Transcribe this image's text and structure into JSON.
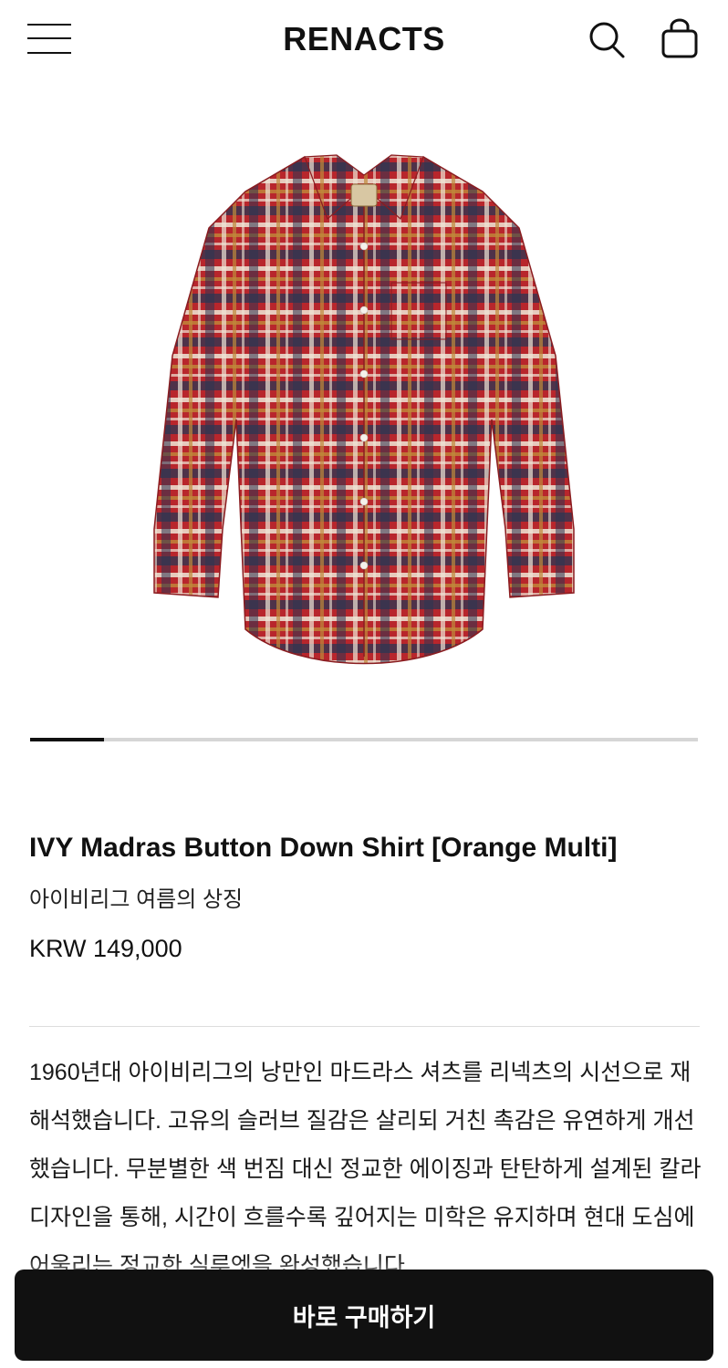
{
  "header": {
    "brand": "RENACTS",
    "menu_icon": "hamburger-menu-icon",
    "search_icon": "search-icon",
    "cart_icon": "shopping-bag-icon"
  },
  "gallery": {
    "image_alt": "IVY Madras Button Down Shirt [Orange Multi]",
    "progress": 0.11
  },
  "product": {
    "name": "IVY Madras Button Down Shirt [Orange Multi]",
    "subtitle": "아이비리그 여름의 상징",
    "price": "KRW 149,000",
    "description": "1960년대 아이비리그의 낭만인 마드라스 셔츠를 리넥츠의 시선으로 재해석했습니다. 고유의 슬러브 질감은 살리되 거친 촉감은 유연하게 개선했습니다. 무분별한 색 번짐 대신 정교한 에이징과 탄탄하게 설계된 칼라 디자인을 통해, 시간이 흐를수록 깊어지는 미학은 유지하며 현대 도심에 어울리는 정교한 실루엣을 완성했습니다."
  },
  "actions": {
    "buy_now_label": "바로 구매하기"
  },
  "colors": {
    "text": "#111111",
    "button_bg": "#111111",
    "button_text": "#ffffff",
    "track": "#d6d6d6",
    "shirt_red": "#b8262c",
    "shirt_navy": "#2b3552",
    "shirt_cream": "#efe6d6",
    "shirt_mustard": "#c08a3a"
  }
}
